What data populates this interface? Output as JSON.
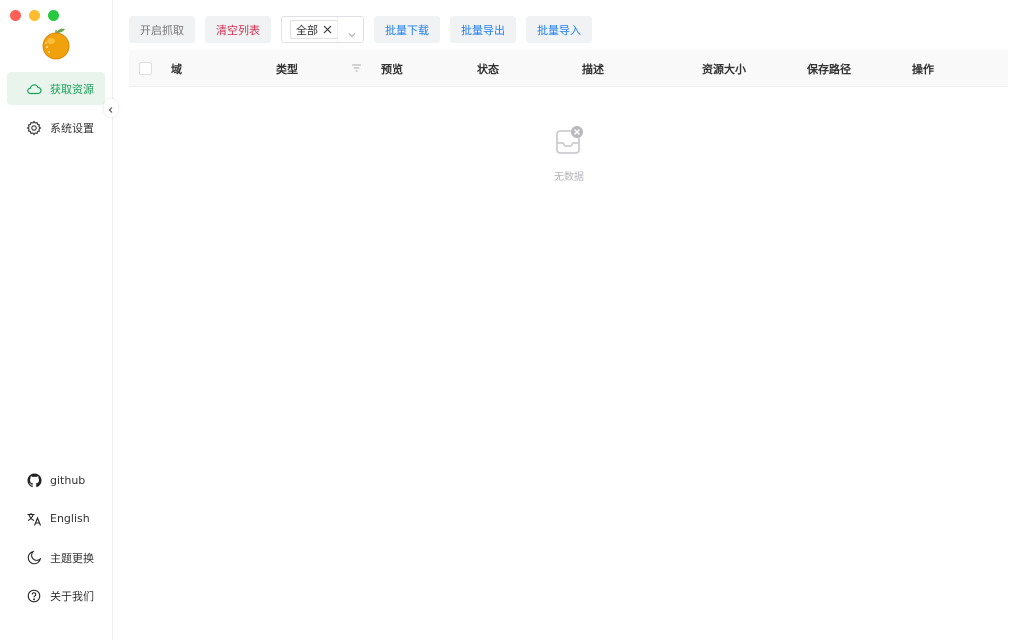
{
  "sidebar": {
    "items": [
      {
        "label": "获取资源",
        "icon": "cloud-icon",
        "active": true
      },
      {
        "label": "系统设置",
        "icon": "gear-icon",
        "active": false
      }
    ],
    "bottom_items": [
      {
        "label": "github",
        "icon": "github-icon"
      },
      {
        "label": "English",
        "icon": "translate-icon"
      },
      {
        "label": "主题更换",
        "icon": "moon-icon"
      },
      {
        "label": "关于我们",
        "icon": "help-circle-icon"
      }
    ]
  },
  "toolbar": {
    "start_capture": "开启抓取",
    "clear_list": "清空列表",
    "filter_tag": "全部",
    "batch_download": "批量下载",
    "batch_export": "批量导出",
    "batch_import": "批量导入"
  },
  "table": {
    "columns": [
      "域",
      "类型",
      "预览",
      "状态",
      "描述",
      "资源大小",
      "保存路径",
      "操作"
    ],
    "rows": []
  },
  "empty": {
    "text": "无数据"
  },
  "colors": {
    "accent": "#18a058",
    "active_bg": "#e9f4ec",
    "danger": "#d03050",
    "info": "#2080f0"
  }
}
